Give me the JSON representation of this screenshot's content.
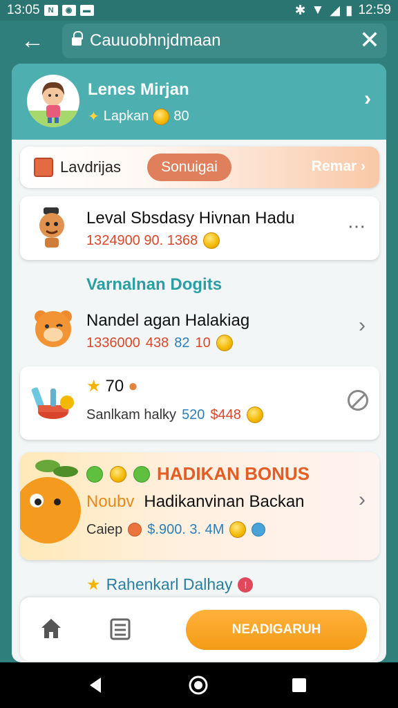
{
  "status_bar": {
    "time": "13:05",
    "clock_right": "12:59"
  },
  "app_bar": {
    "url_text": "Cauuobhnjdmaan"
  },
  "profile": {
    "name": "Lenes Mirjan",
    "subtitle": "Lapkan",
    "coins": "80"
  },
  "tab_bar": {
    "label": "Lavdrijas",
    "pill_label": "Sonuigai",
    "right_label": "Remar"
  },
  "cards": [
    {
      "title": "Leval Sbsdasy Hivnan Hadu",
      "stat_a": "1324900 90. 1368"
    },
    {
      "section": "Varnalnan Dogits",
      "title": "Nandel agan Halakiag",
      "stat_a": "1336000",
      "stat_b": "438",
      "stat_c": "82",
      "stat_d": "10"
    },
    {
      "score": "70",
      "title": "Sanlkam halky",
      "stat_a": "520",
      "stat_b": "$448"
    }
  ],
  "bonus": {
    "title": "HADIKAN BONUS",
    "lead": "Noubv",
    "subtitle": "Hadikanvinan Backan",
    "footer_label": "Caiep",
    "footer_value": "$.900. 3. 4M"
  },
  "daily": {
    "label": "Rahenkarl Dalhay"
  },
  "bottom_nav": {
    "cta_label": "NEADIGARUH"
  },
  "colors": {
    "teal": "#2f7f7c",
    "header": "#4dafb0",
    "accent_orange": "#f39b16",
    "red": "#d9482b",
    "blue": "#2c7fb8"
  },
  "icons": [
    "back-arrow-icon",
    "lock-icon",
    "close-icon",
    "chevron-right-icon",
    "more-icon",
    "block-icon",
    "home-icon",
    "list-icon",
    "star-icon",
    "coin-icon"
  ]
}
